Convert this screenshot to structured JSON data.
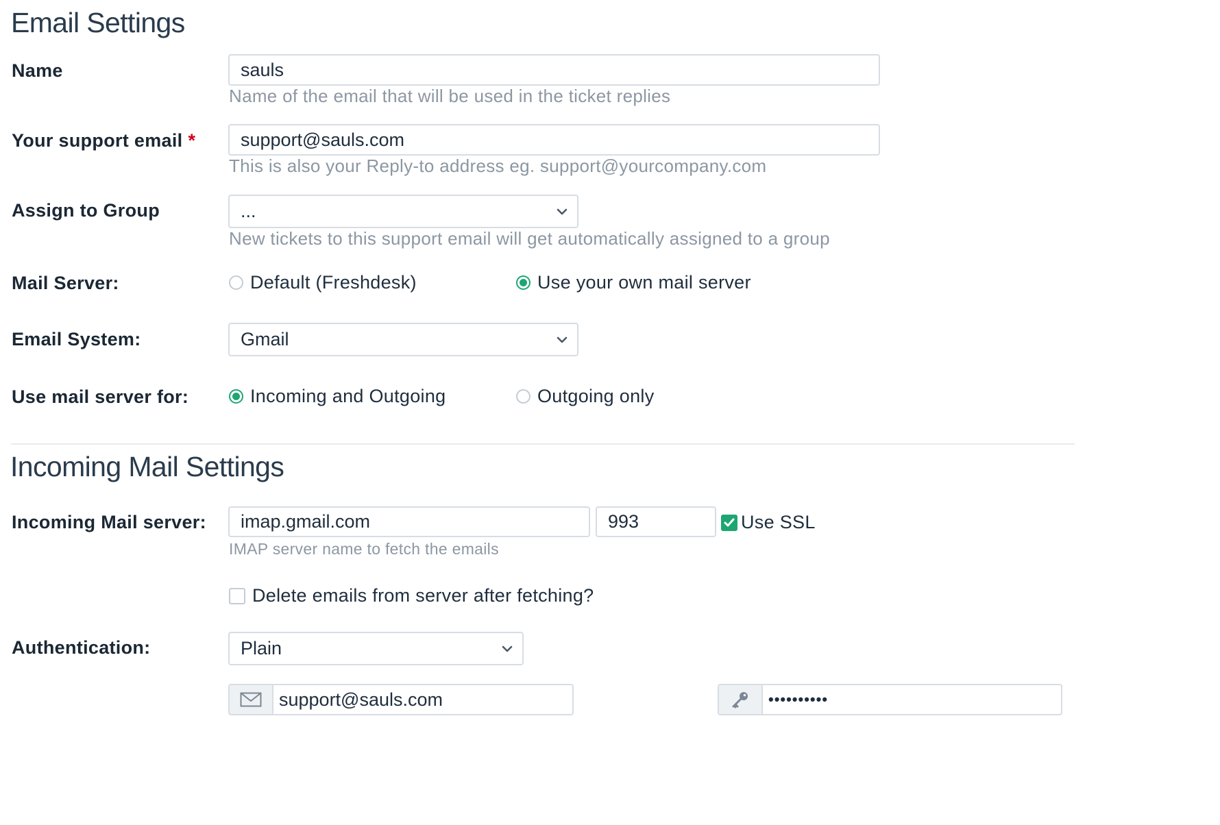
{
  "email_settings": {
    "title": "Email Settings",
    "name": {
      "label": "Name",
      "value": "sauls",
      "help": "Name of the email that will be used in the ticket replies"
    },
    "support_email": {
      "label": "Your support email",
      "required_mark": "*",
      "value": "support@sauls.com",
      "help": "This is also your Reply-to address eg. support@yourcompany.com"
    },
    "assign_group": {
      "label": "Assign to Group",
      "selected": "...",
      "help": "New tickets to this support email will get automatically assigned to a group"
    },
    "mail_server": {
      "label": "Mail Server:",
      "options": [
        {
          "label": "Default (Freshdesk)",
          "selected": false
        },
        {
          "label": "Use your own mail server",
          "selected": true
        }
      ]
    },
    "email_system": {
      "label": "Email System:",
      "selected": "Gmail"
    },
    "mail_server_for": {
      "label": "Use mail server for:",
      "options": [
        {
          "label": "Incoming and Outgoing",
          "selected": true
        },
        {
          "label": "Outgoing only",
          "selected": false
        }
      ]
    }
  },
  "incoming_settings": {
    "title": "Incoming Mail Settings",
    "server": {
      "label": "Incoming Mail server:",
      "host": "imap.gmail.com",
      "port": "993",
      "use_ssl_label": "Use SSL",
      "use_ssl": true,
      "help": "IMAP server name to fetch the emails"
    },
    "delete_after_fetch": {
      "label": "Delete emails from server after fetching?",
      "checked": false
    },
    "authentication": {
      "label": "Authentication:",
      "selected": "Plain",
      "username": "support@sauls.com",
      "password_mask": "••••••••••"
    }
  },
  "icons": {
    "chevron": "chevron-down-icon",
    "envelope": "envelope-icon",
    "key": "key-icon",
    "check": "checkmark-icon"
  },
  "colors": {
    "accent_green": "#1ea672",
    "required_red": "#d0021b",
    "help_gray": "#8c97a3"
  }
}
